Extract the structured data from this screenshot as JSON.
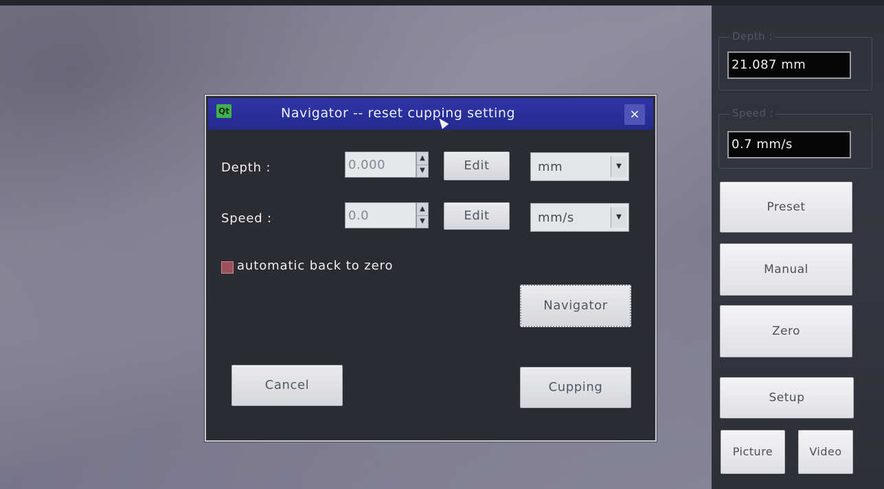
{
  "right_panel": {
    "depth": {
      "title": "Depth :",
      "value": "21.087 mm"
    },
    "speed": {
      "title": "Speed :",
      "value": "0.7 mm/s"
    },
    "buttons": {
      "preset": "Preset",
      "manual": "Manual",
      "zero": "Zero",
      "setup": "Setup",
      "picture": "Picture",
      "video": "Video"
    }
  },
  "dialog": {
    "logo": "Qt",
    "title": "Navigator -- reset cupping setting",
    "close": "×",
    "depth": {
      "label": "Depth :",
      "value": "0.000",
      "edit": "Edit",
      "unit": "mm"
    },
    "speed": {
      "label": "Speed :",
      "value": "0.0",
      "edit": "Edit",
      "unit": "mm/s"
    },
    "auto_zero_label": "automatic back to zero",
    "auto_zero_checked": false,
    "navigator_button": "Navigator",
    "cancel_button": "Cancel",
    "cupping_button": "Cupping"
  },
  "icons": {
    "spin_up": "▲",
    "spin_down": "▼",
    "dropdown": "▼"
  }
}
